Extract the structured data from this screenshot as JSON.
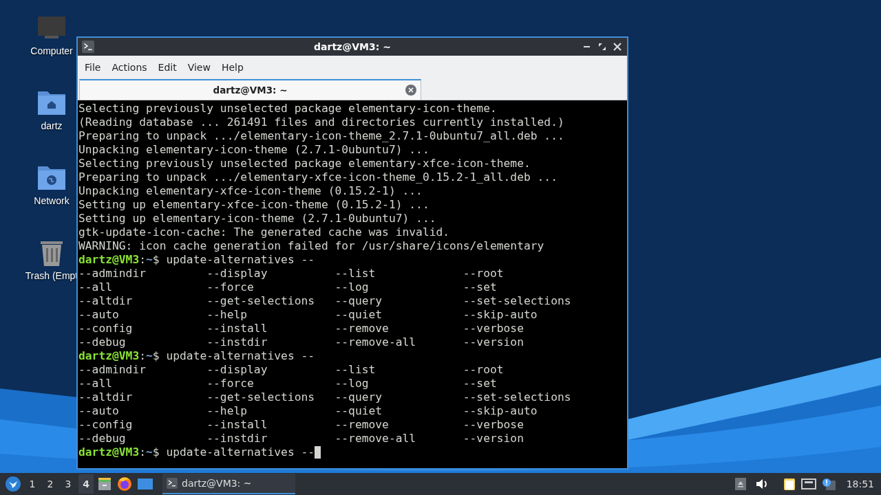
{
  "desktop_icons": [
    {
      "label": "Computer",
      "kind": "computer"
    },
    {
      "label": "dartz",
      "kind": "home"
    },
    {
      "label": "Network",
      "kind": "network"
    },
    {
      "label": "Trash (Empt",
      "kind": "trash"
    }
  ],
  "window": {
    "title": "dartz@VM3: ~",
    "menu": [
      "File",
      "Actions",
      "Edit",
      "View",
      "Help"
    ],
    "tabs": [
      {
        "label": "dartz@VM3: ~",
        "selected": true
      }
    ],
    "terminal": {
      "lines": [
        {
          "kind": "output",
          "text": "Selecting previously unselected package elementary-icon-theme."
        },
        {
          "kind": "output",
          "text": "(Reading database ... 261491 files and directories currently installed.)"
        },
        {
          "kind": "output",
          "text": "Preparing to unpack .../elementary-icon-theme_2.7.1-0ubuntu7_all.deb ..."
        },
        {
          "kind": "output",
          "text": "Unpacking elementary-icon-theme (2.7.1-0ubuntu7) ..."
        },
        {
          "kind": "output",
          "text": "Selecting previously unselected package elementary-xfce-icon-theme."
        },
        {
          "kind": "output",
          "text": "Preparing to unpack .../elementary-xfce-icon-theme_0.15.2-1_all.deb ..."
        },
        {
          "kind": "output",
          "text": "Unpacking elementary-xfce-icon-theme (0.15.2-1) ..."
        },
        {
          "kind": "output",
          "text": "Setting up elementary-xfce-icon-theme (0.15.2-1) ..."
        },
        {
          "kind": "output",
          "text": "Setting up elementary-icon-theme (2.7.1-0ubuntu7) ..."
        },
        {
          "kind": "output",
          "text": "gtk-update-icon-cache: The generated cache was invalid."
        },
        {
          "kind": "output",
          "text": "WARNING: icon cache generation failed for /usr/share/icons/elementary"
        },
        {
          "kind": "prompt",
          "user": "dartz@VM3",
          "sep": ":",
          "path": "~",
          "command": "$ update-alternatives --",
          "cursor": false
        },
        {
          "kind": "output",
          "text": "--admindir         --display          --list             --root"
        },
        {
          "kind": "output",
          "text": "--all              --force            --log              --set"
        },
        {
          "kind": "output",
          "text": "--altdir           --get-selections   --query            --set-selections"
        },
        {
          "kind": "output",
          "text": "--auto             --help             --quiet            --skip-auto"
        },
        {
          "kind": "output",
          "text": "--config           --install          --remove           --verbose"
        },
        {
          "kind": "output",
          "text": "--debug            --instdir          --remove-all       --version"
        },
        {
          "kind": "prompt",
          "user": "dartz@VM3",
          "sep": ":",
          "path": "~",
          "command": "$ update-alternatives --",
          "cursor": false
        },
        {
          "kind": "output",
          "text": "--admindir         --display          --list             --root"
        },
        {
          "kind": "output",
          "text": "--all              --force            --log              --set"
        },
        {
          "kind": "output",
          "text": "--altdir           --get-selections   --query            --set-selections"
        },
        {
          "kind": "output",
          "text": "--auto             --help             --quiet            --skip-auto"
        },
        {
          "kind": "output",
          "text": "--config           --install          --remove           --verbose"
        },
        {
          "kind": "output",
          "text": "--debug            --instdir          --remove-all       --version"
        },
        {
          "kind": "prompt",
          "user": "dartz@VM3",
          "sep": ":",
          "path": "~",
          "command": "$ update-alternatives --",
          "cursor": true
        }
      ]
    }
  },
  "taskbar": {
    "workspaces": [
      {
        "label": "1",
        "selected": false
      },
      {
        "label": "2",
        "selected": false
      },
      {
        "label": "3",
        "selected": false
      },
      {
        "label": "4",
        "selected": true
      }
    ],
    "tasks": [
      {
        "label": "dartz@VM3: ~",
        "selected": true
      }
    ],
    "clock": "18:51"
  }
}
